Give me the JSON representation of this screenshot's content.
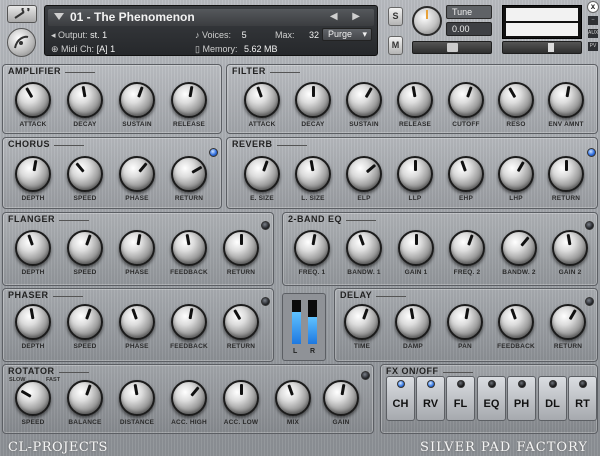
{
  "header": {
    "instrument_name": "01 - The Phenomenon",
    "output_label": "Output:",
    "output_value": "st. 1",
    "voices_label": "Voices:",
    "voices_value": "5",
    "max_label": "Max:",
    "max_value": "32",
    "purge_label": "Purge",
    "midi_label": "Midi Ch:",
    "midi_value": "[A]  1",
    "memory_label": "Memory:",
    "memory_value": "5.62 MB",
    "solo_label": "S",
    "mute_label": "M",
    "tune_label": "Tune",
    "tune_value": "0.00",
    "close_label": "x",
    "aux_label": "AUX",
    "pv_label": "PV",
    "pan_position": 0.5,
    "volume_level": 0.62
  },
  "modules": {
    "amplifier": {
      "title": "AMPLIFIER",
      "knobs": [
        "ATTACK",
        "DECAY",
        "SUSTAIN",
        "RELEASE"
      ]
    },
    "filter": {
      "title": "FILTER",
      "knobs": [
        "ATTACK",
        "DECAY",
        "SUSTAIN",
        "RELEASE",
        "CUTOFF",
        "RESO",
        "ENV AMNT"
      ]
    },
    "chorus": {
      "title": "CHORUS",
      "knobs": [
        "DEPTH",
        "SPEED",
        "PHASE",
        "RETURN"
      ]
    },
    "reverb": {
      "title": "REVERB",
      "knobs": [
        "E. SIZE",
        "L. SIZE",
        "ELP",
        "LLP",
        "EHP",
        "LHP",
        "RETURN"
      ]
    },
    "flanger": {
      "title": "FLANGER",
      "knobs": [
        "DEPTH",
        "SPEED",
        "PHASE",
        "FEEDBACK",
        "RETURN"
      ]
    },
    "eq": {
      "title": "2-BAND EQ",
      "knobs": [
        "FREQ. 1",
        "BANDW. 1",
        "GAIN 1",
        "FREQ. 2",
        "BANDW. 2",
        "GAIN 2"
      ]
    },
    "phaser": {
      "title": "PHASER",
      "knobs": [
        "DEPTH",
        "SPEED",
        "PHASE",
        "FEEDBACK",
        "RETURN"
      ]
    },
    "delay": {
      "title": "DELAY",
      "knobs": [
        "TIME",
        "DAMP",
        "PAN",
        "FEEDBACK",
        "RETURN"
      ]
    },
    "rotator": {
      "title": "ROTATOR",
      "knobs": [
        "SPEED",
        "BALANCE",
        "DISTANCE",
        "ACC. HIGH",
        "ACC. LOW",
        "MIX",
        "GAIN"
      ],
      "slow_label": "SLOW",
      "fast_label": "FAST"
    }
  },
  "meter": {
    "left_label": "L",
    "right_label": "R",
    "left_level": 0.72,
    "right_level": 0.62
  },
  "fx_onoff": {
    "title": "FX ON/OFF",
    "buttons": [
      {
        "label": "CH",
        "on": true
      },
      {
        "label": "RV",
        "on": true
      },
      {
        "label": "FL",
        "on": false
      },
      {
        "label": "EQ",
        "on": false
      },
      {
        "label": "PH",
        "on": false
      },
      {
        "label": "DL",
        "on": false
      },
      {
        "label": "RT",
        "on": false
      }
    ]
  },
  "footer": {
    "left_brand": "CL-PROJECTS",
    "right_brand": "SILVER PAD FACTORY"
  },
  "colors": {
    "led_on": "#2f6ee0",
    "panel_dark": "#2a2c2f",
    "tune_accent": "#e8a23a"
  }
}
